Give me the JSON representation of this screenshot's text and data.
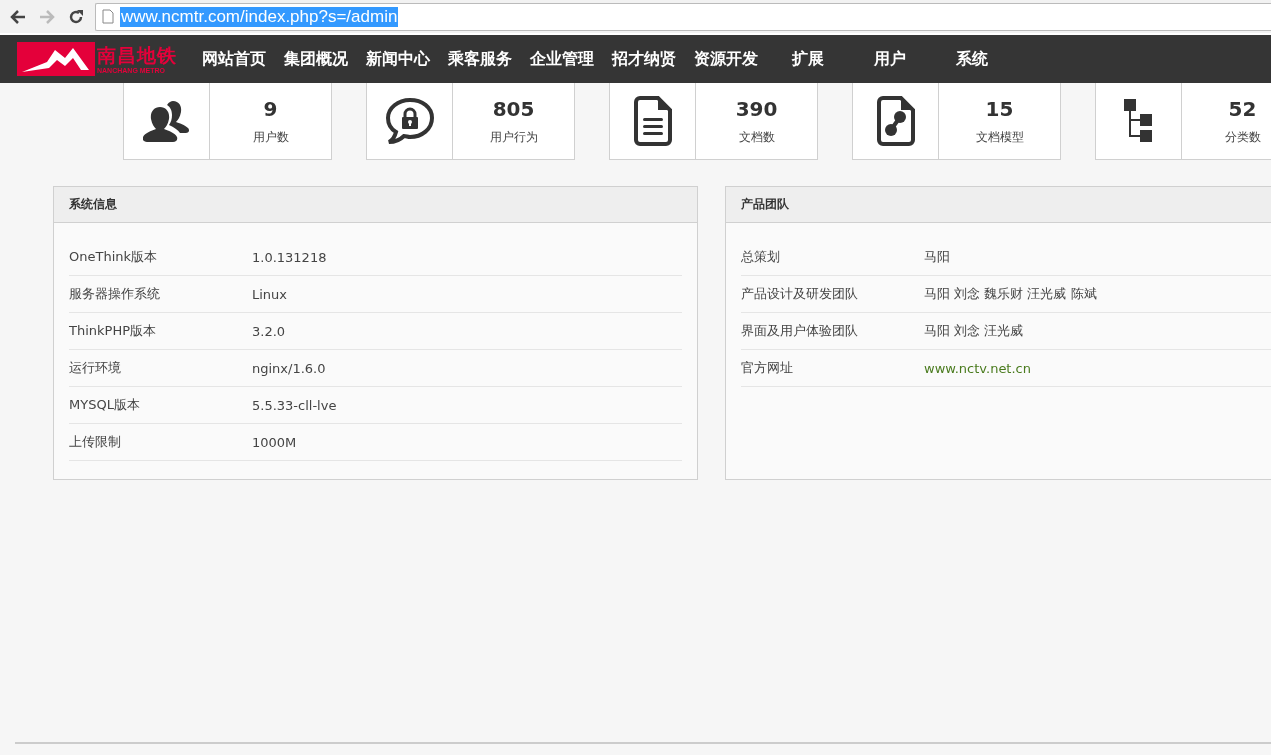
{
  "browser": {
    "url": "www.ncmtr.com/index.php?s=/admin",
    "selected": true
  },
  "logo": {
    "name": "南昌地铁",
    "subtitle": "NANCHANG METRO"
  },
  "nav": [
    "网站首页",
    "集团概况",
    "新闻中心",
    "乘客服务",
    "企业管理",
    "招才纳贤",
    "资源开发",
    "扩展",
    "用户",
    "系统"
  ],
  "stats": [
    {
      "kind": "users",
      "value": "9",
      "label": "用户数"
    },
    {
      "kind": "lock",
      "value": "805",
      "label": "用户行为"
    },
    {
      "kind": "document",
      "value": "390",
      "label": "文档数"
    },
    {
      "kind": "model",
      "value": "15",
      "label": "文档模型"
    },
    {
      "kind": "tree",
      "value": "52",
      "label": "分类数"
    }
  ],
  "panels": [
    {
      "title": "系统信息",
      "rows": [
        {
          "kind": "text",
          "label": "OneThink版本",
          "value": "1.0.131218"
        },
        {
          "kind": "text",
          "label": "服务器操作系统",
          "value": "Linux"
        },
        {
          "kind": "text",
          "label": "ThinkPHP版本",
          "value": "3.2.0"
        },
        {
          "kind": "text",
          "label": "运行环境",
          "value": "nginx/1.6.0"
        },
        {
          "kind": "text",
          "label": "MYSQL版本",
          "value": "5.5.33-cll-lve"
        },
        {
          "kind": "text",
          "label": "上传限制",
          "value": "1000M"
        }
      ]
    },
    {
      "title": "产品团队",
      "rows": [
        {
          "kind": "text",
          "label": "总策划",
          "value": "马阳"
        },
        {
          "kind": "text",
          "label": "产品设计及研发团队",
          "value": "马阳 刘念 魏乐财 汪光威 陈斌"
        },
        {
          "kind": "text",
          "label": "界面及用户体验团队",
          "value": "马阳 刘念 汪光威"
        },
        {
          "kind": "link",
          "label": "官方网址",
          "value": "www.nctv.net.cn"
        }
      ]
    }
  ]
}
